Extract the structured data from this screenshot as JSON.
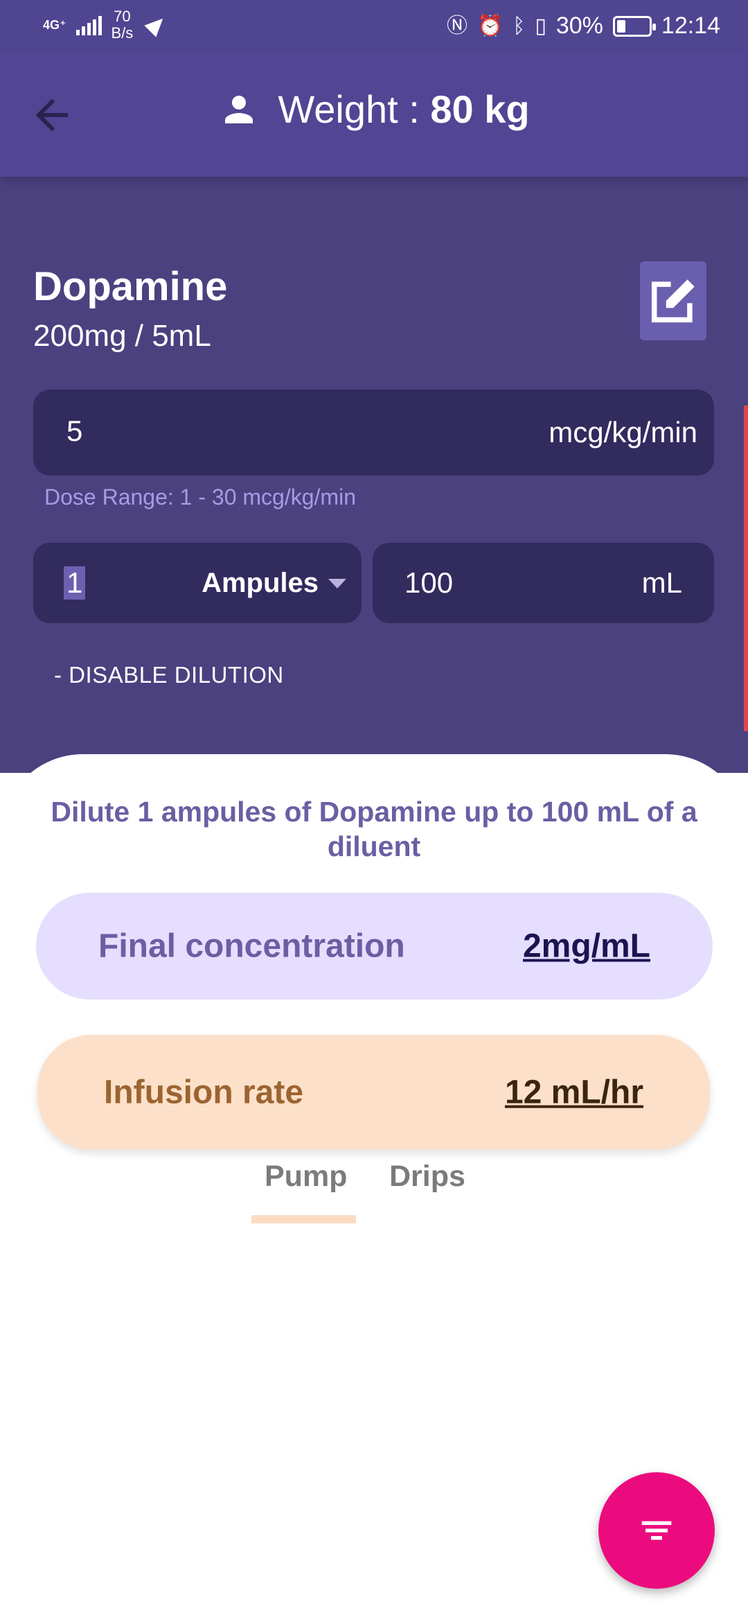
{
  "status_bar": {
    "network": "4G⁺",
    "speed_value": "70",
    "speed_unit": "B/s",
    "battery": "30%",
    "time": "12:14"
  },
  "app_bar": {
    "weight_label": "Weight : ",
    "weight_value": "80 kg"
  },
  "drug": {
    "name": "Dopamine",
    "concentration": "200mg / 5mL"
  },
  "dose": {
    "value": "5",
    "unit": "mcg/kg/min",
    "range_text": "Dose Range: 1 - 30 mcg/kg/min"
  },
  "dilution": {
    "amount_value": "1",
    "amount_unit": "Ampules",
    "volume_value": "100",
    "volume_unit": "mL",
    "toggle_label": "- DISABLE DILUTION"
  },
  "result": {
    "instruction": "Dilute 1 ampules of Dopamine up to 100 mL of a diluent",
    "final_conc_label": "Final concentration",
    "final_conc_value": "2mg/mL",
    "infusion_label": "Infusion rate",
    "infusion_value": "12 mL/hr"
  },
  "tabs": {
    "pump": "Pump",
    "drips": "Drips",
    "selected": "pump"
  },
  "colors": {
    "primary": "#514594",
    "accent": "#ec0b7e",
    "concentration_bg": "#e5defe",
    "infusion_bg": "#fde0c9"
  },
  "icons": {
    "back": "arrow-back-icon",
    "person": "person-icon",
    "edit": "edit-icon",
    "fab": "filter-list-icon"
  }
}
